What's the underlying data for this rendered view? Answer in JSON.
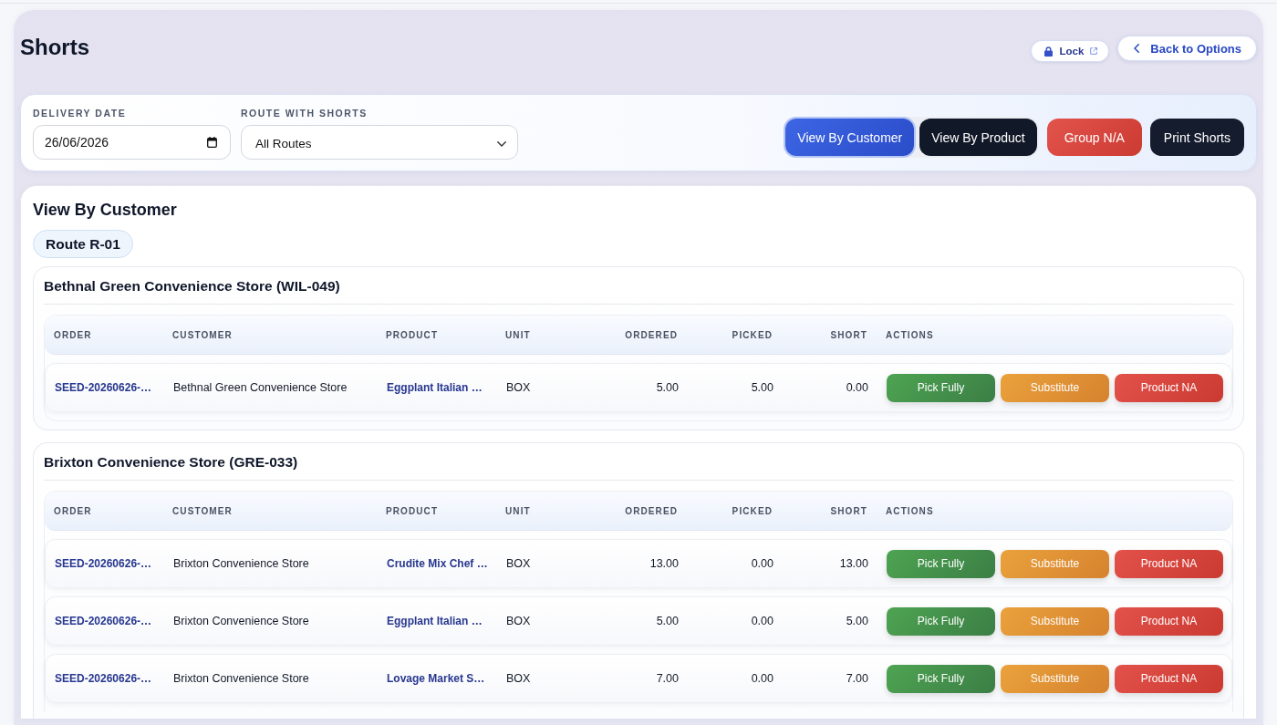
{
  "page": {
    "title": "Shorts"
  },
  "header_actions": [
    {
      "kind": "lock",
      "label": "Lock"
    },
    {
      "kind": "back",
      "label": "Back to Options"
    }
  ],
  "filters": {
    "fields": [
      {
        "kind": "date",
        "label": "DELIVERY DATE",
        "value": "26/06/2026"
      },
      {
        "kind": "select",
        "label": "ROUTE WITH SHORTS",
        "value": "All Routes"
      }
    ],
    "view_toggle": [
      {
        "label": "View By Customer",
        "selected": true
      },
      {
        "label": "View By Product",
        "selected": false
      }
    ],
    "buttons": [
      {
        "kind": "danger",
        "label": "Group N/A"
      },
      {
        "kind": "dark",
        "label": "Print Shorts"
      }
    ]
  },
  "content": {
    "title": "View By Customer",
    "route": "Route R-01",
    "groups": [
      {
        "heading": "Bethnal Green Convenience Store (WIL-049)",
        "columns": [
          {
            "kind": "link",
            "label": "ORDER"
          },
          {
            "kind": "text",
            "label": "CUSTOMER"
          },
          {
            "kind": "link",
            "label": "PRODUCT"
          },
          {
            "kind": "text",
            "label": "UNIT"
          },
          {
            "kind": "number",
            "label": "ORDERED"
          },
          {
            "kind": "number",
            "label": "PICKED"
          },
          {
            "kind": "number",
            "label": "SHORT"
          },
          {
            "kind": "actions",
            "label": "ACTIONS"
          }
        ],
        "rows": [
          {
            "cells": [
              "SEED-20260626-…",
              "Bethnal Green Convenience Store",
              "Eggplant Italian …",
              "BOX",
              "5.00",
              "5.00",
              "0.00"
            ],
            "actions": [
              {
                "kind": "pick",
                "label": "Pick Fully"
              },
              {
                "kind": "substitute",
                "label": "Substitute"
              },
              {
                "kind": "na",
                "label": "Product NA"
              }
            ]
          }
        ]
      },
      {
        "heading": "Brixton Convenience Store (GRE-033)",
        "columns": [
          {
            "kind": "link",
            "label": "ORDER"
          },
          {
            "kind": "text",
            "label": "CUSTOMER"
          },
          {
            "kind": "link",
            "label": "PRODUCT"
          },
          {
            "kind": "text",
            "label": "UNIT"
          },
          {
            "kind": "number",
            "label": "ORDERED"
          },
          {
            "kind": "number",
            "label": "PICKED"
          },
          {
            "kind": "number",
            "label": "SHORT"
          },
          {
            "kind": "actions",
            "label": "ACTIONS"
          }
        ],
        "rows": [
          {
            "cells": [
              "SEED-20260626-…",
              "Brixton Convenience Store",
              "Crudite Mix Chef …",
              "BOX",
              "13.00",
              "0.00",
              "13.00"
            ],
            "actions": [
              {
                "kind": "pick",
                "label": "Pick Fully"
              },
              {
                "kind": "substitute",
                "label": "Substitute"
              },
              {
                "kind": "na",
                "label": "Product NA"
              }
            ]
          },
          {
            "cells": [
              "SEED-20260626-…",
              "Brixton Convenience Store",
              "Eggplant Italian …",
              "BOX",
              "5.00",
              "0.00",
              "5.00"
            ],
            "actions": [
              {
                "kind": "pick",
                "label": "Pick Fully"
              },
              {
                "kind": "substitute",
                "label": "Substitute"
              },
              {
                "kind": "na",
                "label": "Product NA"
              }
            ]
          },
          {
            "cells": [
              "SEED-20260626-…",
              "Brixton Convenience Store",
              "Lovage Market S…",
              "BOX",
              "7.00",
              "0.00",
              "7.00"
            ],
            "actions": [
              {
                "kind": "pick",
                "label": "Pick Fully"
              },
              {
                "kind": "substitute",
                "label": "Substitute"
              },
              {
                "kind": "na",
                "label": "Product NA"
              }
            ]
          }
        ]
      }
    ]
  }
}
